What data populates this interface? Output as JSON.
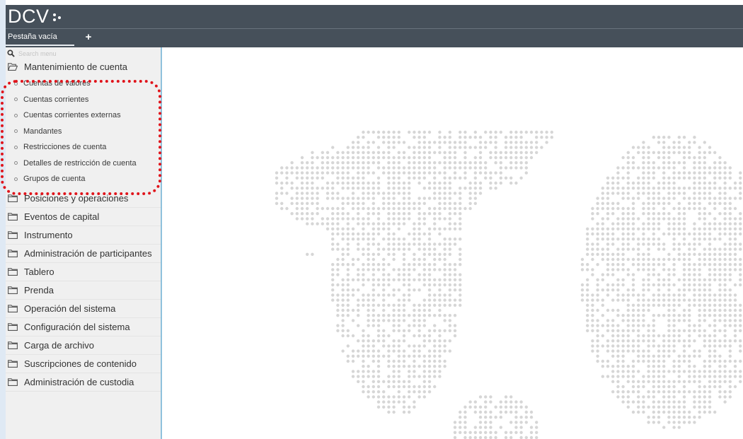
{
  "app": {
    "logo_text": "DCV"
  },
  "tabs": [
    {
      "label": "Pestaña vacía",
      "active": true
    }
  ],
  "tab_add_label": "+",
  "search": {
    "placeholder": "Search menu"
  },
  "menu": {
    "expanded_label": "Mantenimiento de cuenta",
    "sub_items": [
      "Cuentas de valores",
      "Cuentas corrientes",
      "Cuentas corrientes externas",
      "Mandantes",
      "Restricciones de cuenta",
      "Detalles de restricción de cuenta",
      "Grupos de cuenta"
    ],
    "items": [
      "Posiciones y operaciones",
      "Eventos de capital",
      "Instrumento",
      "Administración de participantes",
      "Tablero",
      "Prenda",
      "Operación del sistema",
      "Configuración del sistema",
      "Carga de archivo",
      "Suscripciones de contenido",
      "Administración de custodia"
    ]
  },
  "colors": {
    "header_bg": "#46505a",
    "sidebar_bg": "#f0f0f0",
    "highlight": "#e0141b",
    "map_dot": "#d6d6d6"
  },
  "icons": {
    "search": "search-icon",
    "folder_open": "folder-open-icon",
    "folder": "folder-icon",
    "add": "plus-icon"
  }
}
